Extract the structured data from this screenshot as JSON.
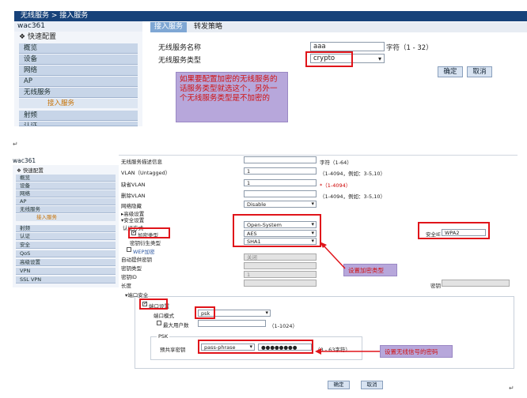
{
  "top": {
    "breadcrumb": "无线服务 > 接入服务",
    "device_name": "wac361",
    "quick_config": "快速配置",
    "nav_items": [
      "概览",
      "设备",
      "网络",
      "AP",
      "无线服务",
      "射频",
      "认证"
    ],
    "nav_sub_item": "接入服务",
    "tabs": [
      "接入服务",
      "转发策略"
    ],
    "service_name_label": "无线服务名称",
    "service_name_value": "aaa",
    "service_name_hint": "字符（1 - 32）",
    "service_type_label": "无线服务类型",
    "service_type_value": "crypto",
    "confirm_label": "确定",
    "cancel_label": "取消",
    "note": "如果要配置加密的无线服务的话服务类型就选这个，另外一个无线服务类型是不加密的"
  },
  "bottom": {
    "device_name": "wac361",
    "quick_config": "快速配置",
    "nav_items": [
      "概览",
      "设备",
      "网络",
      "AP",
      "无线服务"
    ],
    "nav_sub_item": "接入服务",
    "nav_items_after": [
      "射频",
      "认证",
      "安全",
      "QoS",
      "高级设置",
      "VPN",
      "SSL VPN"
    ],
    "desc_label": "无线服务描述信息",
    "desc_hint": "字符（1-64）",
    "vlan_untagged_label": "VLAN（Untagged）",
    "vlan_untagged_value": "1",
    "vlan_untagged_hint": "（1-4094，例如：3-5,10）",
    "default_vlan_label": "缺省VLAN",
    "default_vlan_value": "1",
    "default_vlan_hint": "*（1-4094）",
    "delete_vlan_label": "删除VLAN",
    "delete_vlan_hint": "（1-4094，例如：3-5,10）",
    "net_hide_label": "网络隐藏",
    "net_hide_value": "Disable",
    "advanced_label": "▸高级设置",
    "security_label": "▾安全设置",
    "auth_mode_label": "认证方式",
    "auth_mode_value": "Open-System",
    "cipher_type_label": "加密类型",
    "cipher_type_value": "AES",
    "key_mode_label": "密钥衍生类型",
    "key_mode_value": "SHA1",
    "security_ie_label": "安全IE",
    "security_ie_value": "WPA2",
    "wep_label": "WEP加密",
    "auto_key_label": "自动提供密钥",
    "auto_key_value": "关闭",
    "key_type_label": "密钥类型",
    "key_id_label": "密钥ID",
    "key_id_value": "1",
    "length_label": "长度",
    "key_label": "密钥",
    "port_security_label": "▾端口安全",
    "port_set_label": "端口设置",
    "port_mode_label": "端口模式",
    "port_mode_value": "psk",
    "max_users_label": "最大用户数",
    "max_users_hint": "（1-1024）",
    "psk_legend": "PSK",
    "preshared_label": "预共享密钥",
    "preshared_type_value": "pass-phrase",
    "preshared_value": "●●●●●●●●",
    "preshared_hint": "（8 - 63字符）",
    "confirm_label": "确定",
    "cancel_label": "取消",
    "note_cipher": "设置加密类型",
    "note_password": "设置无线信号的密码"
  },
  "colors": {
    "header_blue": "#17427a",
    "tab_active": "#7fa7d4",
    "highlight_red": "#e0141a",
    "note_bg": "#b7a7db",
    "note_text": "#d01111",
    "nav_sub_orange": "#c77000"
  }
}
